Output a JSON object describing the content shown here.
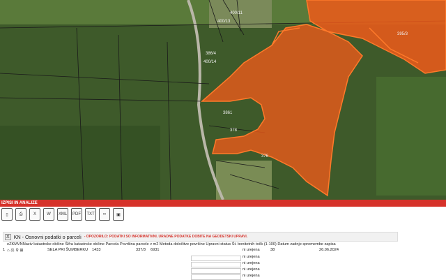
{
  "map": {
    "parcel_labels": [
      "400/11",
      "400/13",
      "395/3",
      "378",
      "386/4",
      "400/14",
      "3861",
      "376"
    ]
  },
  "toolbar": {
    "title": "IZPISI IN ANALIZE"
  },
  "icons": [
    "new-document-icon",
    "print-icon",
    "excel-icon",
    "word-icon",
    "xml-icon",
    "pdf-icon",
    "txt-icon",
    "link-icon",
    "image-icon"
  ],
  "icon_labels": {
    "excel": "X",
    "word": "W",
    "xml": "XML",
    "pdf": "PDF",
    "txt": "TXT"
  },
  "panel": {
    "close": "X",
    "title": "KN - Osnovni podatki o parceli",
    "warning": "- OPOZORILO: PODATKI SO INFORMATIVNI. URADNE PODATKE DOBITE NA GEODETSKI UPRAVI.",
    "header": "eZKMVNNaziv katastrske občine Šifra katastrske občine Parcela Površina parcele v m2 Metoda določitve površine Upravni status Št. bonitetnih točk (1-100) Datum zadnje spremembe zapisa",
    "row": {
      "num": "1",
      "name": "SELA PRI ŠUMBERKU",
      "code": "1433",
      "parcel": "337/3",
      "area": "6931",
      "status": "ni urejena",
      "points": "38",
      "date": "26.06.2024"
    },
    "extra_status": [
      "ni urejena",
      "ni urejena",
      "ni urejena",
      "ni urejena",
      "ni urejena"
    ]
  }
}
